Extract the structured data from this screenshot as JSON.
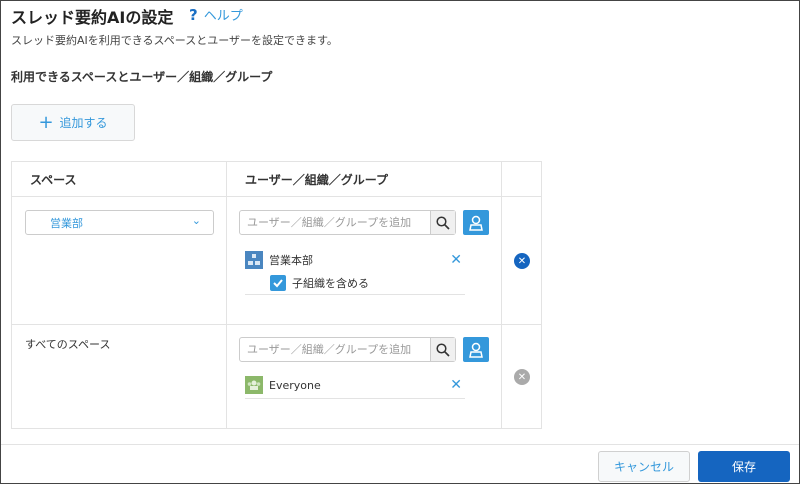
{
  "header": {
    "title": "スレッド要約AIの設定",
    "help_label": "ヘルプ",
    "help_icon": "question-icon"
  },
  "description": "スレッド要約AIを利用できるスペースとユーザーを設定できます。",
  "section_title": "利用できるスペースとユーザー／組織／グループ",
  "add_button": "追加する",
  "table": {
    "headers": {
      "space": "スペース",
      "users": "ユーザー／組織／グループ"
    },
    "rows": [
      {
        "space_select": "営業部",
        "search_placeholder": "ユーザー／組織／グループを追加",
        "entries": [
          {
            "name": "営業本部",
            "type": "organization",
            "include_children_label": "子組織を含める",
            "include_children": true
          }
        ],
        "delete_enabled": true
      },
      {
        "space_text": "すべてのスペース",
        "search_placeholder": "ユーザー／組織／グループを追加",
        "entries": [
          {
            "name": "Everyone",
            "type": "group"
          }
        ],
        "delete_enabled": false
      }
    ]
  },
  "footer": {
    "cancel": "キャンセル",
    "save": "保存"
  },
  "colors": {
    "accent": "#3498db",
    "primary": "#1565c0",
    "delete_active": "#1565c0",
    "delete_disabled": "#aaaaaa"
  }
}
